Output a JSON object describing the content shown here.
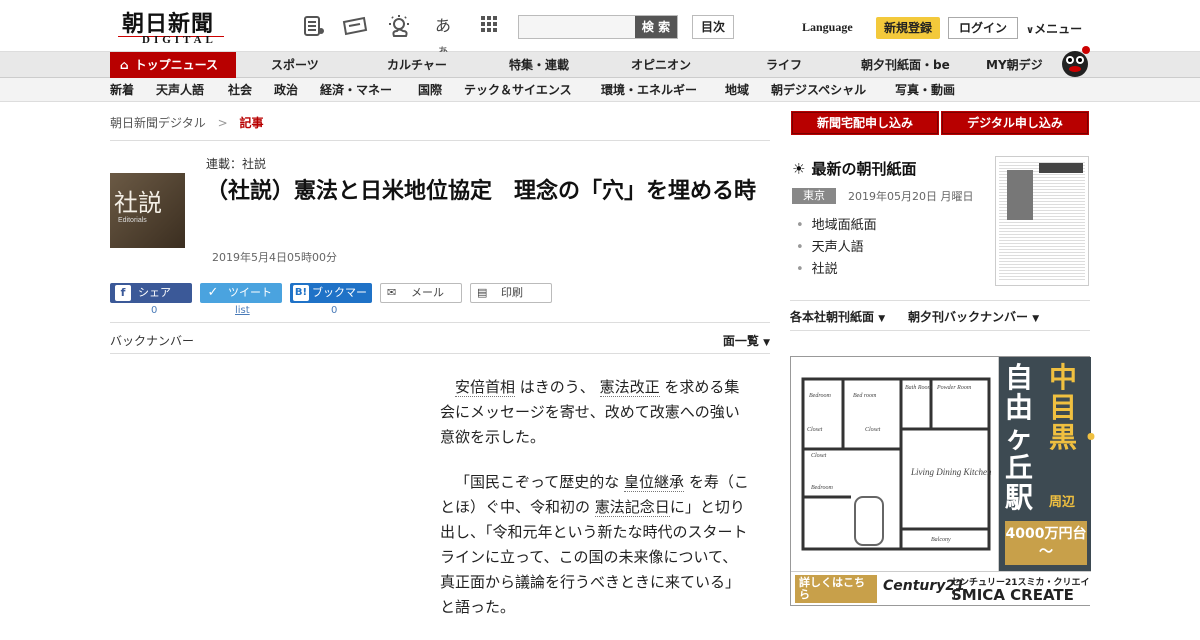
{
  "header": {
    "logo_main": "朝日新聞",
    "logo_sub": "DIGITAL",
    "search_placeholder": "",
    "search_button": "検 索",
    "contents_button": "目次",
    "language": "Language",
    "register": "新規登録",
    "login": "ログイン",
    "menu": "メニュー"
  },
  "nav_main": {
    "top_news": "トップニュース",
    "items": [
      "スポーツ",
      "カルチャー",
      "特集・連載",
      "オピニオン",
      "ライフ",
      "朝夕刊紙面・be",
      "MY朝デジ"
    ]
  },
  "nav_sub": {
    "items": [
      "新着",
      "天声人語",
      "社会",
      "政治",
      "経済・マネー",
      "国際",
      "テック＆サイエンス",
      "環境・エネルギー",
      "地域",
      "朝デジスペシャル",
      "写真・動画"
    ]
  },
  "breadcrumb": {
    "home": "朝日新聞デジタル",
    "sep": ">",
    "current": "記事"
  },
  "article": {
    "thumb_kanji": "社説",
    "thumb_en": "Editorials",
    "series": "連載：社説",
    "title": "（社説）憲法と日米地位協定　理念の「穴」を埋める時",
    "date": "2019年5月4日05時00分",
    "paragraphs": [
      [
        "",
        "安倍首相",
        "はきのう、",
        "憲法改正",
        "を求める集会にメッセージを寄せ、改めて改憲への強い意欲を示した。"
      ],
      [
        "「国民こぞって歴史的な",
        "皇位継承",
        "を寿（ことほ）ぐ中、令和初の",
        "憲法記念日",
        "に」と切り出し、「令和元年という新たな時代のスタートラインに立って、この国の未来像について、真正面から議論を行うべきときに来ている」と語った。"
      ]
    ]
  },
  "share": {
    "facebook": "シェア",
    "facebook_count": "0",
    "twitter": "ツイート",
    "twitter_count": "list",
    "hatena": "ブックマーク",
    "hatena_count": "0",
    "mail": "メール",
    "print": "印刷"
  },
  "backnumber": {
    "label": "バックナンバー",
    "list": "面一覧"
  },
  "sidebar": {
    "subscribe_paper": "新聞宅配申し込み",
    "subscribe_digital": "デジタル申し込み",
    "latest_heading": "最新の朝刊紙面",
    "region": "東京",
    "date": "2019年05月20日 月曜日",
    "links": [
      "地域面紙面",
      "天声人語",
      "社説"
    ],
    "menu_morning": "各本社朝刊紙面",
    "menu_back": "朝夕刊バックナンバー"
  },
  "ad": {
    "plan_labels": [
      "Bedroom",
      "Bed room",
      "Bath Room",
      "Powder Room",
      "Living Dining Kitchen",
      "Bedroom",
      "Balcony",
      "Closet",
      "Closet",
      "Closet"
    ],
    "area_top": "中目黒・",
    "area_bottom": "自由ヶ丘駅",
    "area_around": "周辺",
    "price": "4000万円台～",
    "cta": "詳しくはこちら",
    "brand": "Century21",
    "brand_jp": "センチュリー21スミカ・クリエイト",
    "brand_en": "SMICA CREATE"
  }
}
